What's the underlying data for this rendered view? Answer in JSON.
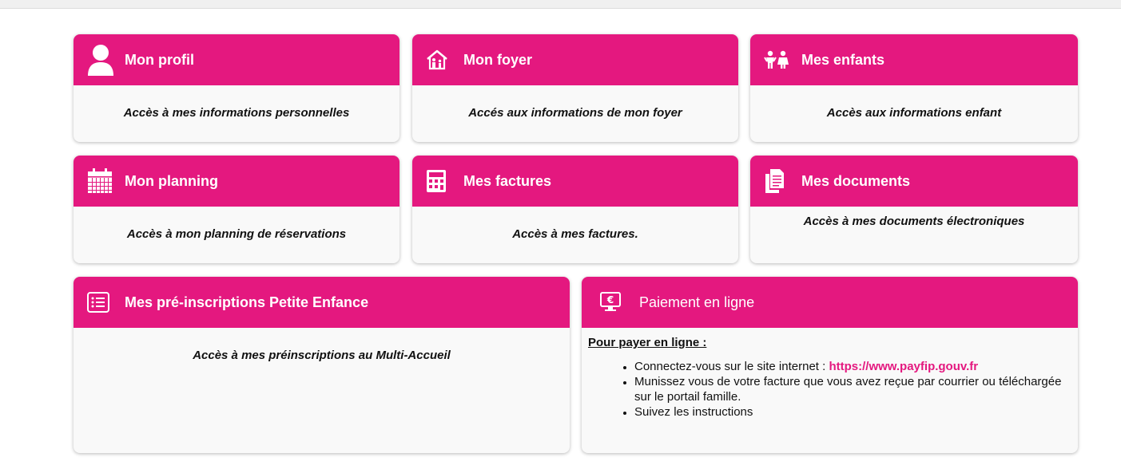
{
  "theme": {
    "accent": "#e4187f"
  },
  "cards": {
    "profil": {
      "title": "Mon profil",
      "description": "Accès à mes informations personnelles",
      "icon": "user-icon"
    },
    "foyer": {
      "title": "Mon foyer",
      "description": "Accés aux informations de mon foyer",
      "icon": "home-family-icon"
    },
    "enfants": {
      "title": "Mes enfants",
      "description": "Accès aux informations enfant",
      "icon": "children-icon"
    },
    "planning": {
      "title": "Mon planning",
      "description": "Accès à mon planning de réservations",
      "icon": "calendar-icon"
    },
    "factures": {
      "title": "Mes factures",
      "description": "Accès à mes factures.",
      "icon": "calculator-icon"
    },
    "documents": {
      "title": "Mes documents",
      "description": "Accès à mes documents électroniques",
      "icon": "documents-icon"
    },
    "preinscriptions": {
      "title": "Mes pré-inscriptions Petite Enfance",
      "description": "Accès à mes préinscriptions au Multi-Accueil",
      "icon": "list-icon"
    },
    "paiement": {
      "title": "Paiement en ligne",
      "icon": "euro-screen-icon",
      "subtitle": "Pour payer en ligne :",
      "step1_text": "Connectez-vous sur le site internet : ",
      "step1_link": "https://www.payfip.gouv.fr",
      "step2_text": "Munissez vous de votre facture que vous avez reçue par courrier ou téléchargée sur le portail famille.",
      "step3_text": "Suivez les instructions"
    }
  }
}
